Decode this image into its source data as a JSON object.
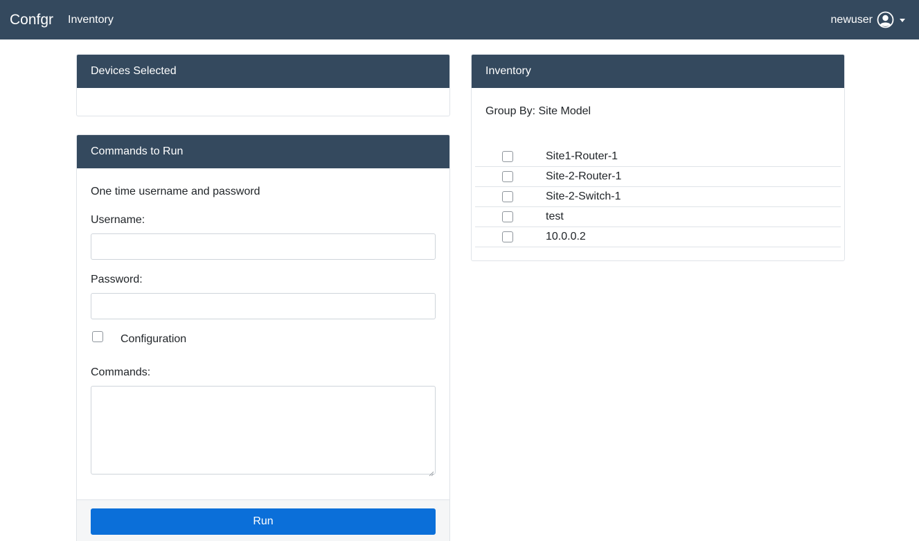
{
  "navbar": {
    "brand": "Confgr",
    "nav_link": "Inventory",
    "username": "newuser"
  },
  "devices_card": {
    "title": "Devices Selected"
  },
  "commands_card": {
    "title": "Commands to Run",
    "intro": "One time username and password",
    "username_label": "Username:",
    "username_value": "",
    "password_label": "Password:",
    "password_value": "",
    "configuration_label": "Configuration",
    "configuration_checked": false,
    "commands_label": "Commands:",
    "commands_value": "",
    "run_label": "Run"
  },
  "inventory_card": {
    "title": "Inventory",
    "group_by_label": "Group By:",
    "group_by_options": [
      "Site",
      "Model"
    ],
    "devices": [
      {
        "name": "Site1-Router-1",
        "checked": false
      },
      {
        "name": "Site-2-Router-1",
        "checked": false
      },
      {
        "name": "Site-2-Switch-1",
        "checked": false
      },
      {
        "name": "test",
        "checked": false
      },
      {
        "name": "10.0.0.2",
        "checked": false
      }
    ]
  },
  "colors": {
    "navbar_bg": "#34495e",
    "card_header_bg": "#34495e",
    "primary_button": "#0b6fd9"
  }
}
